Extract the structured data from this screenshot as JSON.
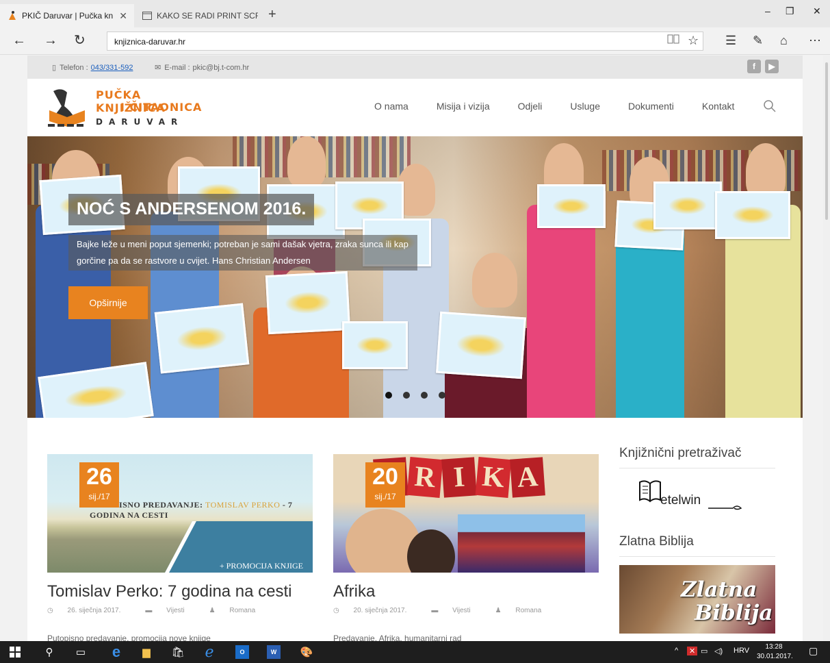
{
  "browser": {
    "tabs": [
      {
        "label": "PKIČ Daruvar | Pučka kn",
        "active": true
      },
      {
        "label": "KAKO SE RADI PRINT SCREE",
        "active": false
      }
    ],
    "url": "knjiznica-daruvar.hr",
    "window_controls": {
      "minimize": "–",
      "restore": "❐",
      "close": "✕"
    }
  },
  "site": {
    "topbar": {
      "phone_label": "Telefon :",
      "phone": "043/331-592",
      "email_label": "E-mail :",
      "email": "pkic@bj.t-com.hr",
      "social": [
        "f",
        "▶"
      ]
    },
    "logo": {
      "line1": "PUČKA KNJIŽNICA",
      "line2": "I ČITAONICA",
      "line3": "DARUVAR"
    },
    "menu": [
      "O nama",
      "Misija i vizija",
      "Odjeli",
      "Usluge",
      "Dokumenti",
      "Kontakt"
    ],
    "hero": {
      "title": "NOĆ S ANDERSENOM 2016.",
      "text": "Bajke leže u meni poput sjemenki; potreban je sami dašak vjetra, zraka sunca ili kap gorčine pa da se rastvore u cvijet. Hans Christian Andersen",
      "button": "Opširnije",
      "slides": 4,
      "active_slide": 1
    },
    "posts": [
      {
        "day": "26",
        "month": "sij./17",
        "image_caption_prefix": "PUTOPISNO PREDAVANJE:",
        "image_caption_name": "TOMISLAV PERKO",
        "image_caption_suffix": "- 7 GODINA NA CESTI",
        "image_promo": "+ PROMOCIJA KNJIGE",
        "title": "Tomislav Perko: 7 godina na cesti",
        "date": "26. siječnja 2017.",
        "category": "Vijesti",
        "author": "Romana",
        "excerpt": "Putopisno predavanje, promocija nove knjige"
      },
      {
        "day": "20",
        "month": "sij./17",
        "image_letters": [
          "F",
          "R",
          "I",
          "K",
          "A"
        ],
        "title": "Afrika",
        "date": "20. siječnja 2017.",
        "category": "Vijesti",
        "author": "Romana",
        "excerpt": "Predavanje, Afrika, humanitarni rad"
      }
    ],
    "sidebar": {
      "widget1_title": "Knjižnični pretraživač",
      "metel_text": "etelwin",
      "widget2_title": "Zlatna Biblija",
      "biblija_line1": "Zlatna",
      "biblija_line2": "Biblija"
    }
  },
  "taskbar": {
    "tray_lang": "HRV",
    "time": "13:28",
    "date": "30.01.2017."
  },
  "colors": {
    "accent_orange": "#e8831f",
    "link_blue": "#1a5ebd",
    "taskbar": "#1e1e1e"
  }
}
